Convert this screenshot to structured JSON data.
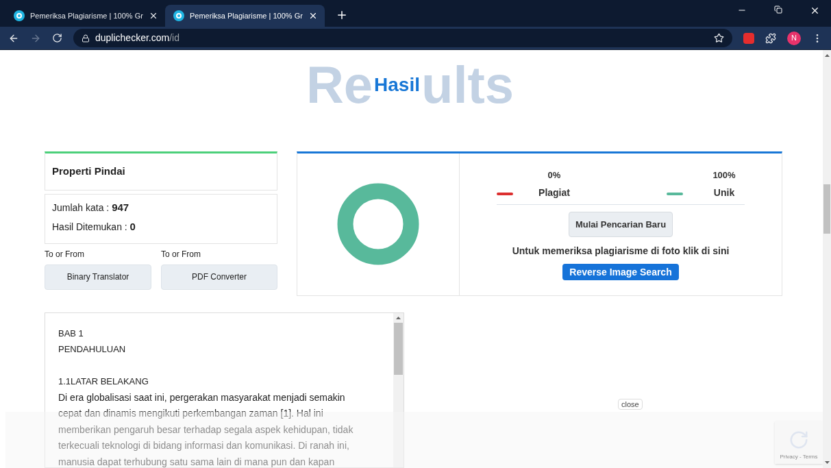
{
  "browser": {
    "tabs": [
      {
        "title": "Pemeriksa Plagiarisme | 100% Gr",
        "selected": false
      },
      {
        "title": "Pemeriksa Plagiarisme | 100% Gr",
        "selected": true
      }
    ],
    "url": {
      "host": "duplichecker.com",
      "path": "/id"
    },
    "profile_initial": "N"
  },
  "page": {
    "backdrop_title": [
      "Re",
      "ults"
    ],
    "title": "Hasil",
    "scan": {
      "heading": "Properti Pindai",
      "stats": [
        {
          "label": "Jumlah kata : ",
          "value": "947"
        },
        {
          "label": "Hasil Ditemukan : ",
          "value": "0"
        }
      ],
      "tools": [
        {
          "caption": "To or From",
          "button": "Binary Translator"
        },
        {
          "caption": "To or From",
          "button": "PDF Converter"
        }
      ]
    },
    "result": {
      "legend": [
        {
          "percent": "0%",
          "label": "Plagiat",
          "color": "#dc2f2f"
        },
        {
          "percent": "100%",
          "label": "Unik",
          "color": "#58b99b"
        }
      ],
      "new_search": "Mulai Pencarian Baru",
      "photo_note": "Untuk memeriksa plagiarisme di foto klik di sini",
      "reverse_search": "Reverse Image Search"
    },
    "document": {
      "title_lines": [
        "BAB 1",
        "PENDAHULUAN"
      ],
      "section": "1.1LATAR BELAKANG",
      "paragraph": "Di era globalisasi saat ini, pergerakan masyarakat menjadi semakin cepat dan dinamis mengikuti perkembangan zaman [1]. Hal ini memberikan pengaruh besar terhadap segala aspek kehidupan, tidak terkecuali teknologi di bidang informasi dan komunikasi. Di ranah ini, manusia dapat terhubung satu sama lain di mana pun dan kapan"
    },
    "ad_close": "close",
    "recaptcha": "Privacy - Terms"
  }
}
